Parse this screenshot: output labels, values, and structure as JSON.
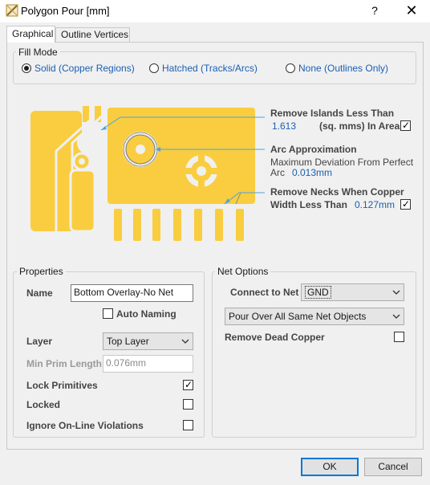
{
  "window": {
    "title": "Polygon Pour [mm]",
    "help_label": "?",
    "close_label": "✕"
  },
  "tabs": [
    {
      "label": "Graphical",
      "active": true
    },
    {
      "label": "Outline Vertices",
      "active": false
    }
  ],
  "fill_mode": {
    "title": "Fill Mode",
    "options": [
      {
        "label": "Solid (Copper Regions)",
        "selected": true
      },
      {
        "label": "Hatched (Tracks/Arcs)",
        "selected": false
      },
      {
        "label": "None (Outlines Only)",
        "selected": false
      }
    ]
  },
  "graphic_options": {
    "remove_islands": {
      "label": "Remove Islands Less Than",
      "value": "1.613",
      "unit_label": "(sq. mms) In Area",
      "checked": true
    },
    "arc_approximation": {
      "label": "Arc Approximation",
      "desc_line1": "Maximum Deviation From Perfect",
      "desc_line2": "Arc",
      "value": "0.013mm"
    },
    "remove_necks": {
      "label_line1": "Remove Necks When Copper",
      "label_line2": "Width Less Than",
      "value": "0.127mm",
      "checked": true
    }
  },
  "properties": {
    "title": "Properties",
    "name_label": "Name",
    "name_value": "Bottom Overlay-No Net",
    "auto_naming_label": "Auto Naming",
    "auto_naming_checked": false,
    "layer_label": "Layer",
    "layer_value": "Top Layer",
    "min_prim_label": "Min Prim Length",
    "min_prim_value": "0.076mm",
    "lock_primitives_label": "Lock Primitives",
    "lock_primitives_checked": true,
    "locked_label": "Locked",
    "locked_checked": false,
    "ignore_label": "Ignore On-Line Violations",
    "ignore_checked": false
  },
  "net_options": {
    "title": "Net Options",
    "connect_label": "Connect to Net",
    "connect_value": "GND",
    "pour_value": "Pour Over All Same Net Objects",
    "remove_dead_label": "Remove Dead Copper",
    "remove_dead_checked": false
  },
  "footer": {
    "ok_label": "OK",
    "cancel_label": "Cancel"
  },
  "colors": {
    "copper": "#f9cd3f",
    "accent_blue": "#1a5fb4",
    "guide_line": "#4aa3df"
  }
}
